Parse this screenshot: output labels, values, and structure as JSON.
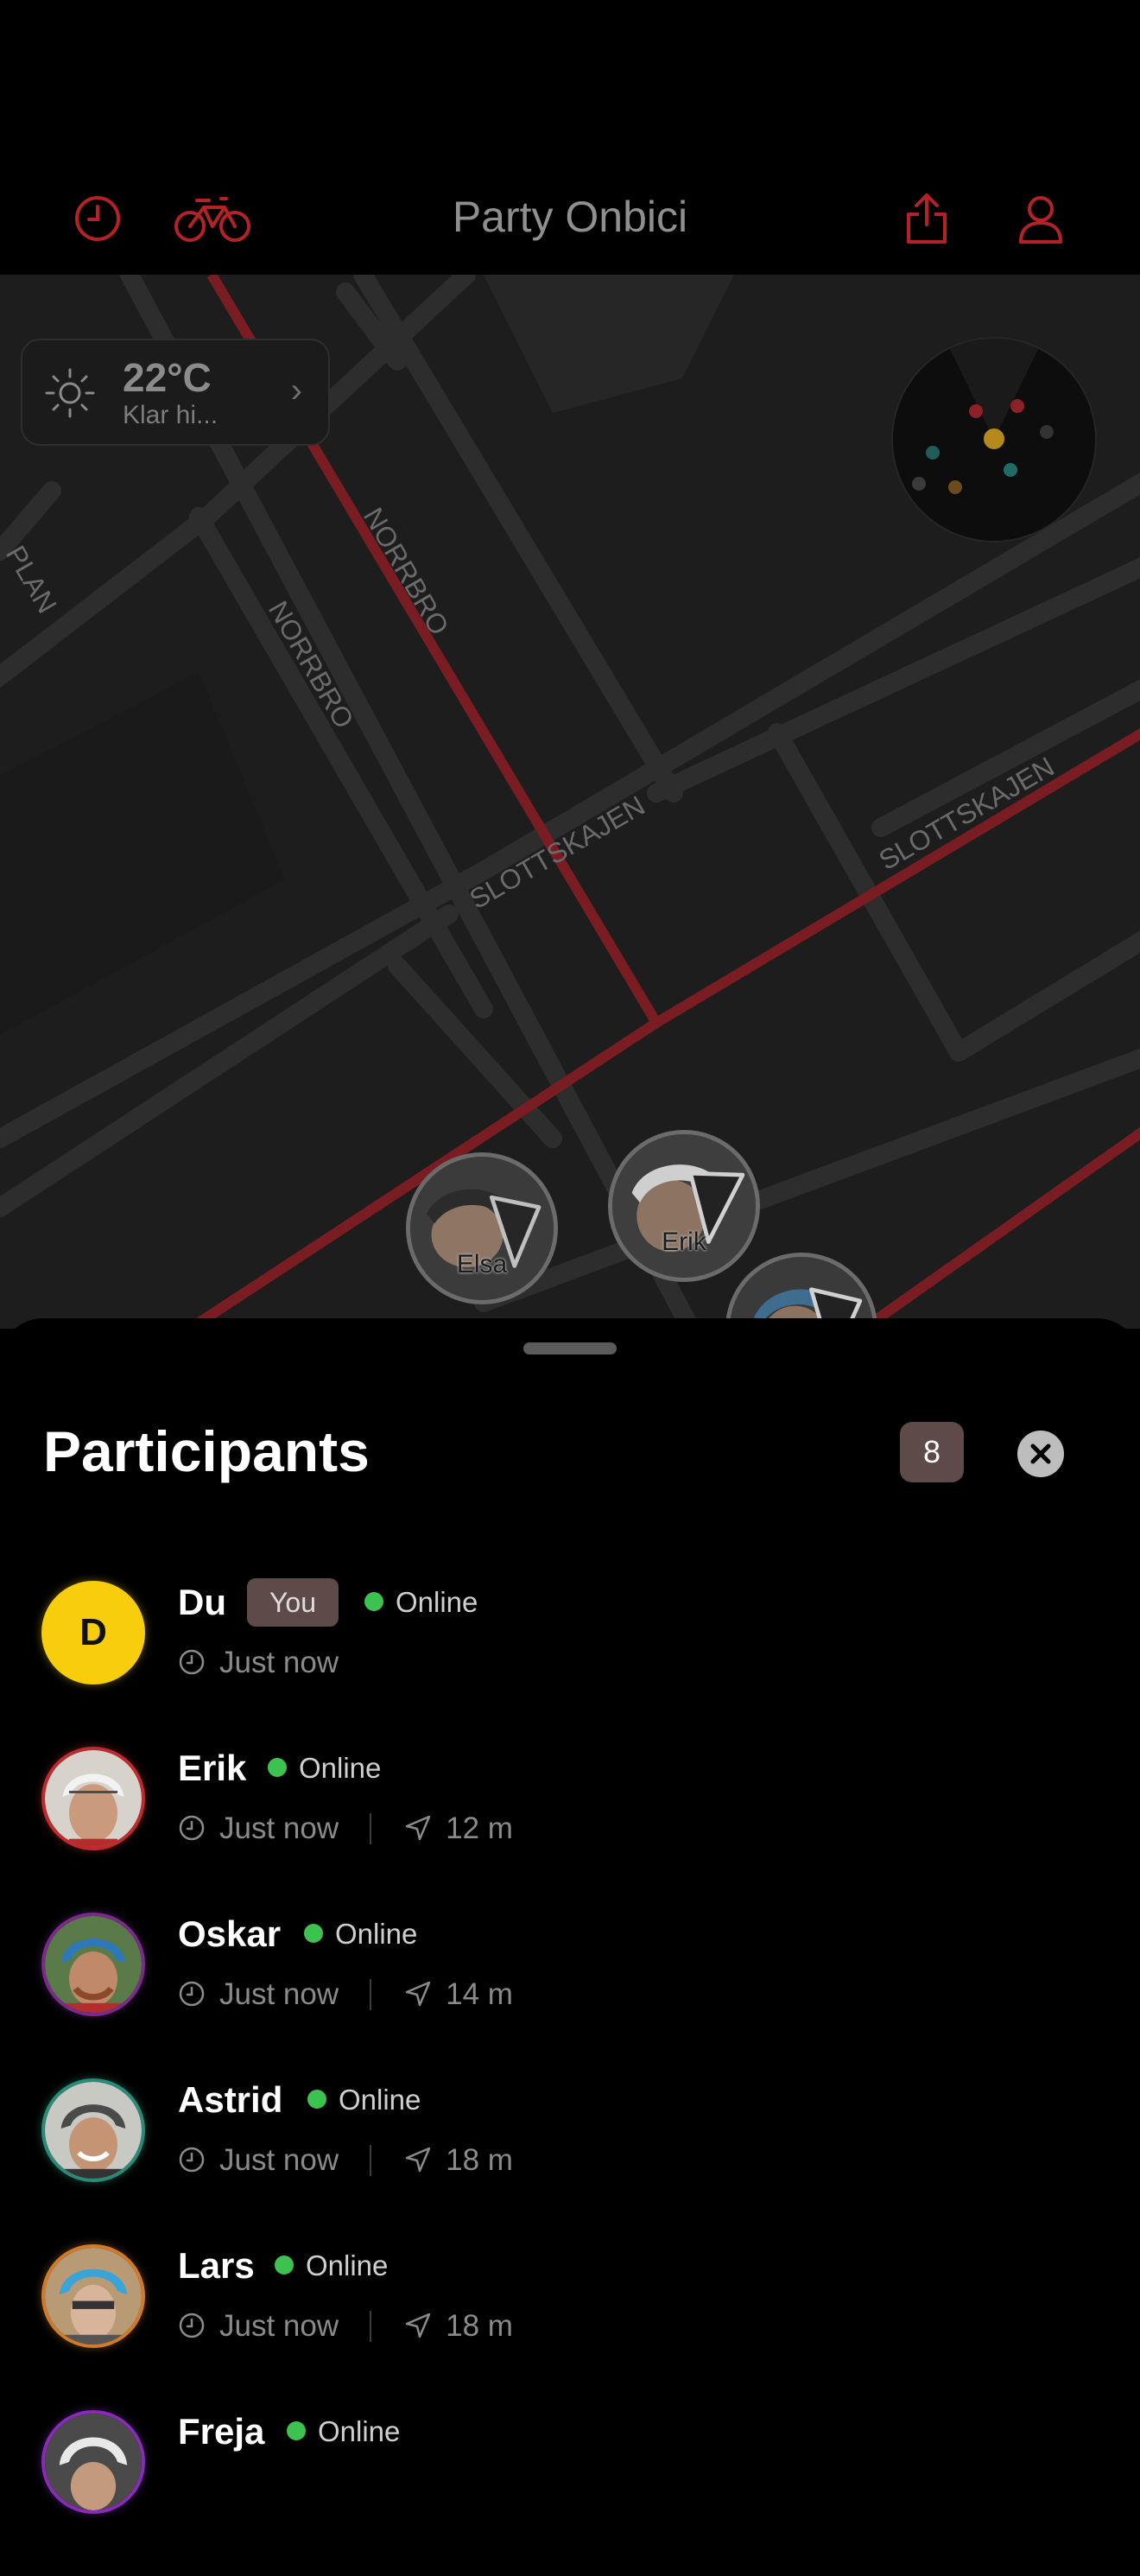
{
  "header": {
    "title": "Party Onbici"
  },
  "weather": {
    "temperature": "22°C",
    "condition": "Klar hi..."
  },
  "map": {
    "street_labels": [
      "NORRBRO",
      "NORRBRO",
      "SLOTTSKAJEN",
      "SLOTTSKAJEN",
      "PLAN"
    ],
    "markers": [
      {
        "label": "Elsa"
      },
      {
        "label": "Erik"
      }
    ]
  },
  "sheet": {
    "title": "Participants",
    "count": "8",
    "participants": [
      {
        "name": "Du",
        "initial": "D",
        "badge": "You",
        "status": "Online",
        "last_seen": "Just now",
        "distance": ""
      },
      {
        "name": "Erik",
        "status": "Online",
        "last_seen": "Just now",
        "distance": "12 m"
      },
      {
        "name": "Oskar",
        "status": "Online",
        "last_seen": "Just now",
        "distance": "14 m"
      },
      {
        "name": "Astrid",
        "status": "Online",
        "last_seen": "Just now",
        "distance": "18 m"
      },
      {
        "name": "Lars",
        "status": "Online",
        "last_seen": "Just now",
        "distance": "18 m"
      },
      {
        "name": "Freja",
        "status": "Online",
        "last_seen": "",
        "distance": ""
      }
    ]
  },
  "colors": {
    "accent": "#c8262b",
    "online": "#3cc24e",
    "badge": "#5e4a48",
    "self_avatar": "#f7cd0c"
  }
}
